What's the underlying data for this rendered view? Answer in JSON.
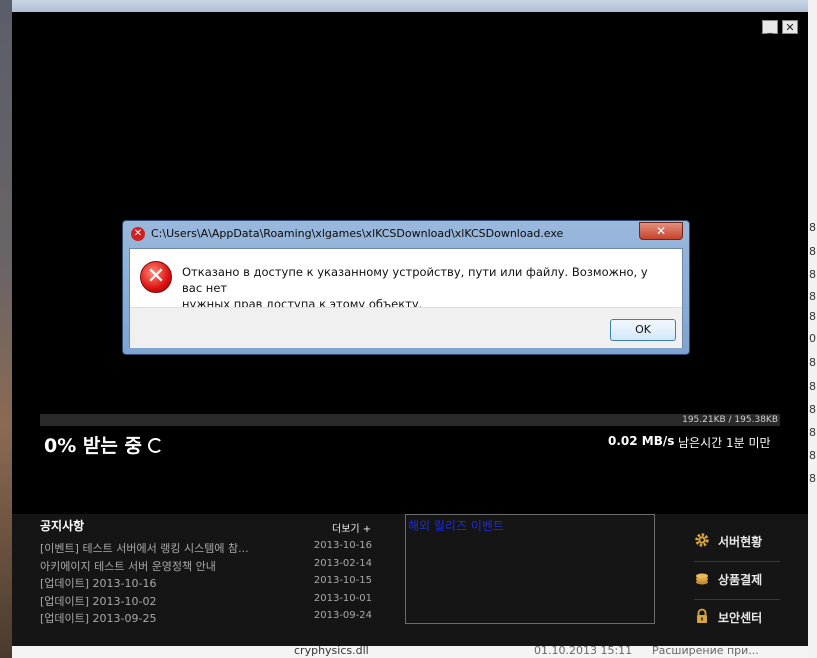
{
  "background": {
    "right_edge_chars": [
      "8",
      "8",
      "8",
      "8",
      "8",
      "0",
      "8",
      "8",
      "8",
      "8",
      "8",
      "8"
    ],
    "bottom_file_name": "cryphysics.dll",
    "bottom_date": "01.10.2013 15:11",
    "bottom_type": "Расширение при..."
  },
  "window_controls": {
    "minimize": "_",
    "close": "✕"
  },
  "download": {
    "size_text": "195.21KB / 195.38KB",
    "percent_text": "0% 받는 중",
    "speed": "0.02 MB/s",
    "remaining": "남은시간 1분 미만",
    "progress_fraction": 0
  },
  "notices": {
    "title": "공지사항",
    "more_label": "더보기 +",
    "items": [
      {
        "title": "[이벤트] 테스트 서버에서 랭킹 시스템에 참...",
        "date": "2013-10-16"
      },
      {
        "title": "아키에이지 테스트 서버 운영정책 안내",
        "date": "2013-02-14"
      },
      {
        "title": "[업데이트] 2013-10-16",
        "date": "2013-10-15"
      },
      {
        "title": "[업데이트] 2013-10-02",
        "date": "2013-10-01"
      },
      {
        "title": "[업데이트] 2013-09-25",
        "date": "2013-09-24"
      }
    ]
  },
  "event_box": {
    "label": "해외 릴리즈 이벤트"
  },
  "side_menu": [
    {
      "label": "서버현황",
      "icon": "gear-icon"
    },
    {
      "label": "상품결제",
      "icon": "coins-icon"
    },
    {
      "label": "보안센터",
      "icon": "lock-icon"
    }
  ],
  "dialog": {
    "title": "C:\\Users\\A\\AppData\\Roaming\\xlgames\\xlKCSDownload\\xlKCSDownload.exe",
    "close_label": "✕",
    "message_line1": "Отказано в доступе к указанному устройству, пути или файлу. Возможно,  у вас нет",
    "message_line2": "нужных прав доступа к этому объекту.",
    "ok_label": "OK"
  }
}
